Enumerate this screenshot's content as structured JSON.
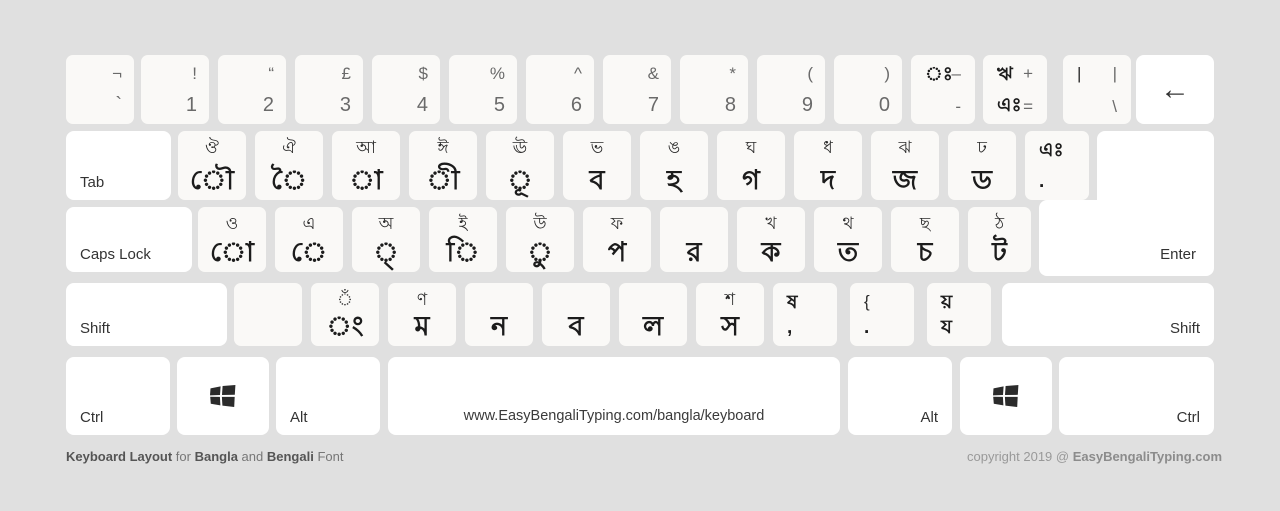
{
  "page": {
    "background": "#e0e0e0",
    "key_face_color": "#faf9f7",
    "modifier_key_color": "#ffffff"
  },
  "footer": {
    "left": {
      "part1": "Keyboard Layout",
      "part2": " for ",
      "part3": "Bangla",
      "part4": " and ",
      "part5": "Bengali",
      "part6": " Font"
    },
    "right": {
      "copyright": "copyright 2019 @ ",
      "brand": "EasyBengaliTyping.com"
    }
  },
  "spacebar": {
    "label": "www.EasyBengaliTyping.com/bangla/keyboard"
  },
  "modifiers": {
    "tab": "Tab",
    "caps_lock": "Caps Lock",
    "shift_left": "Shift",
    "shift_right": "Shift",
    "enter": "Enter",
    "ctrl_left": "Ctrl",
    "ctrl_right": "Ctrl",
    "alt_left": "Alt",
    "alt_right": "Alt",
    "win_left": "windows-logo",
    "win_right": "windows-logo",
    "backspace": "←"
  },
  "rows": {
    "number_row": [
      {
        "name": "key-grave",
        "top": "¬",
        "bottom": "`"
      },
      {
        "name": "key-1",
        "top": "!",
        "bottom": "1"
      },
      {
        "name": "key-2",
        "top": "“",
        "bottom": "2"
      },
      {
        "name": "key-3",
        "top": "£",
        "bottom": "3"
      },
      {
        "name": "key-4",
        "top": "$",
        "bottom": "4"
      },
      {
        "name": "key-5",
        "top": "%",
        "bottom": "5"
      },
      {
        "name": "key-6",
        "top": "^",
        "bottom": "6"
      },
      {
        "name": "key-7",
        "top": "&",
        "bottom": "7"
      },
      {
        "name": "key-8",
        "top": "*",
        "bottom": "8"
      },
      {
        "name": "key-9",
        "top": "(",
        "bottom": "9"
      },
      {
        "name": "key-0",
        "top": ")",
        "bottom": "0"
      }
    ],
    "number_row_quad": [
      {
        "name": "key-minus",
        "top_left": "ঃ",
        "top_right": "–",
        "bottom_left": "",
        "bottom_right": "-"
      },
      {
        "name": "key-equal",
        "top_left": "ঋ",
        "top_right": "+",
        "bottom_left": "এঃ",
        "bottom_right": "="
      },
      {
        "name": "key-backslash",
        "top_left": "|",
        "top_right": "|",
        "bottom_left": "",
        "bottom_right": "\\"
      }
    ],
    "tab_row": [
      {
        "name": "key-q",
        "top": "ঔ",
        "bottom": "ৌ"
      },
      {
        "name": "key-w",
        "top": "ঐ",
        "bottom": "ৈ"
      },
      {
        "name": "key-e",
        "top": "আ",
        "bottom": "া"
      },
      {
        "name": "key-r",
        "top": "ঈ",
        "bottom": "ী"
      },
      {
        "name": "key-t",
        "top": "ঊ",
        "bottom": "ূ"
      },
      {
        "name": "key-y",
        "top": "ভ",
        "bottom": "ব"
      },
      {
        "name": "key-u",
        "top": "ঙ",
        "bottom": "হ"
      },
      {
        "name": "key-i",
        "top": "ঘ",
        "bottom": "গ"
      },
      {
        "name": "key-o",
        "top": "ধ",
        "bottom": "দ"
      },
      {
        "name": "key-p",
        "top": "ঝ",
        "bottom": "জ"
      },
      {
        "name": "key-bracket-left",
        "top": "ঢ",
        "bottom": "ড"
      },
      {
        "name": "key-bracket-right",
        "top": "এঃ",
        "bottom": "."
      }
    ],
    "home_row": [
      {
        "name": "key-a",
        "top": "ও",
        "bottom": "ো"
      },
      {
        "name": "key-s",
        "top": "এ",
        "bottom": "ে"
      },
      {
        "name": "key-d",
        "top": "অ",
        "bottom": "্"
      },
      {
        "name": "key-f",
        "top": "ই",
        "bottom": "ি"
      },
      {
        "name": "key-g",
        "top": "উ",
        "bottom": "ু"
      },
      {
        "name": "key-h",
        "top": "ফ",
        "bottom": "প"
      },
      {
        "name": "key-j",
        "top": "",
        "bottom": "র"
      },
      {
        "name": "key-k",
        "top": "খ",
        "bottom": "ক"
      },
      {
        "name": "key-l",
        "top": "থ",
        "bottom": "ত"
      },
      {
        "name": "key-semicolon",
        "top": "ছ",
        "bottom": "চ"
      },
      {
        "name": "key-apostrophe",
        "top": "ঠ",
        "bottom": "ট"
      }
    ],
    "shift_row": [
      {
        "name": "key-backslash-left",
        "top": "",
        "bottom": ""
      },
      {
        "name": "key-z",
        "top": "ঁ",
        "bottom": "ং"
      },
      {
        "name": "key-x",
        "top": "ণ",
        "bottom": "ম"
      },
      {
        "name": "key-c",
        "top": "",
        "bottom": "ন"
      },
      {
        "name": "key-v",
        "top": "",
        "bottom": "ব"
      },
      {
        "name": "key-b",
        "top": "",
        "bottom": "ল"
      },
      {
        "name": "key-n",
        "top": "শ",
        "bottom": "স"
      },
      {
        "name": "key-m",
        "top": "ষ",
        "bottom": ","
      },
      {
        "name": "key-comma",
        "top": "{",
        "bottom": "."
      },
      {
        "name": "key-period",
        "top": "য়",
        "bottom": "য"
      }
    ]
  }
}
